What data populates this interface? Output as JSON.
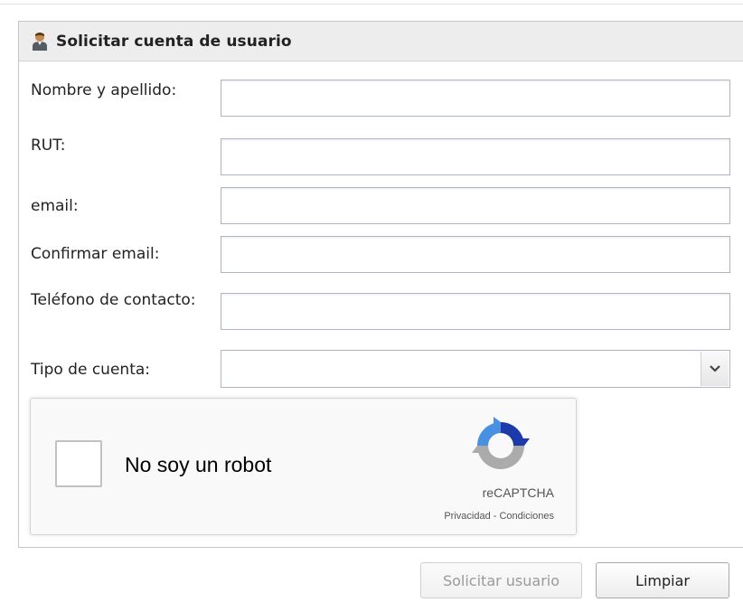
{
  "panel": {
    "title": "Solicitar cuenta de usuario"
  },
  "form": {
    "fields": [
      {
        "label": "Nombre y apellido:",
        "value": ""
      },
      {
        "label": "RUT:",
        "value": ""
      },
      {
        "label": "email:",
        "value": ""
      },
      {
        "label": "Confirmar email:",
        "value": ""
      },
      {
        "label": "Teléfono de contacto:",
        "value": ""
      }
    ],
    "account_type": {
      "label": "Tipo de cuenta:",
      "selected": ""
    }
  },
  "captcha": {
    "checkbox_label": "No soy un robot",
    "brand": "reCAPTCHA",
    "links": "Privacidad - Condiciones",
    "checked": false
  },
  "buttons": {
    "submit_label": "Solicitar usuario",
    "submit_disabled": true,
    "clear_label": "Limpiar"
  },
  "colors": {
    "header_bg": "#ededed",
    "input_border": "#aeb6c5",
    "captcha_blue": "#4a90e2",
    "captcha_gray": "#b0b0b0"
  },
  "icons": {
    "header": "user-icon",
    "select": "chevron-down-icon",
    "captcha": "recaptcha-logo-icon"
  }
}
